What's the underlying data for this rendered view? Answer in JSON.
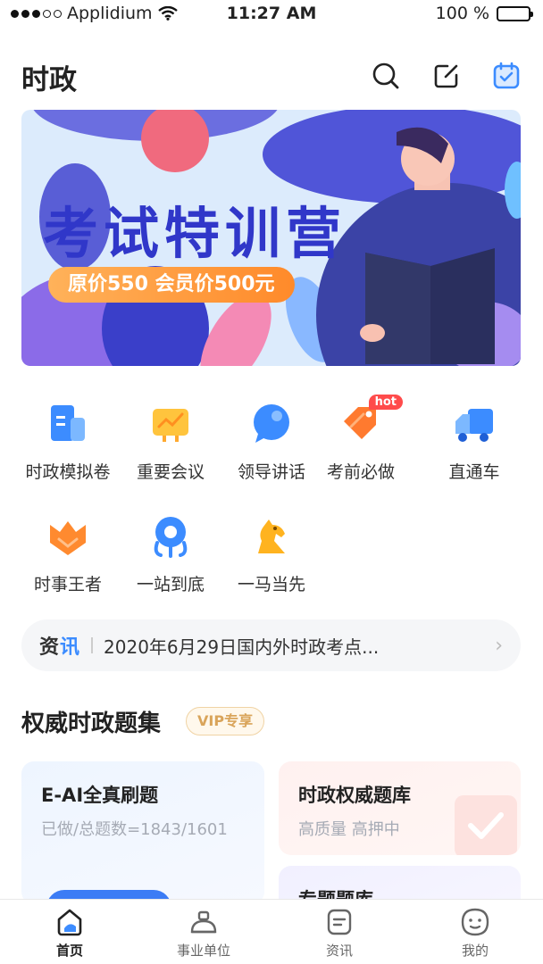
{
  "status_bar": {
    "carrier": "Applidium",
    "time": "11:27 AM",
    "battery": "100 %"
  },
  "header": {
    "title": "时政",
    "icons": [
      "search-icon",
      "edit-icon",
      "calendar-check-icon"
    ]
  },
  "banner": {
    "title": "考试特训营",
    "price": "原价550  会员价500元"
  },
  "quick_links": [
    {
      "label": "时政模拟卷",
      "icon": "document-icon",
      "badge": ""
    },
    {
      "label": "重要会议",
      "icon": "chart-board-icon",
      "badge": ""
    },
    {
      "label": "领导讲话",
      "icon": "chat-bubble-icon",
      "badge": ""
    },
    {
      "label": "考前必做",
      "icon": "tag-icon",
      "badge": "hot"
    },
    {
      "label": "直通车",
      "icon": "truck-icon",
      "badge": ""
    },
    {
      "label": "时事王者",
      "icon": "crown-icon",
      "badge": ""
    },
    {
      "label": "一站到底",
      "icon": "location-icon",
      "badge": ""
    },
    {
      "label": "一马当先",
      "icon": "horse-icon",
      "badge": ""
    }
  ],
  "news": {
    "tag_part1": "资",
    "tag_part2": "讯",
    "text": "2020年6月29日国内外时政考点..."
  },
  "section": {
    "title": "权威时政题集",
    "vip": "VIP专享"
  },
  "cards": [
    {
      "title": "E-AI全真刷题",
      "subtitle": "已做/总题数=1843/1601"
    },
    {
      "title": "时政权威题库",
      "subtitle": "高质量 高押中"
    },
    {
      "title": "专题题库",
      "subtitle": ""
    }
  ],
  "tabs": [
    {
      "label": "首页",
      "icon": "home-icon",
      "active": true
    },
    {
      "label": "事业单位",
      "icon": "briefcase-icon",
      "active": false
    },
    {
      "label": "资讯",
      "icon": "news-icon",
      "active": false
    },
    {
      "label": "我的",
      "icon": "profile-icon",
      "active": false
    }
  ],
  "colors": {
    "accent": "#3c8cff",
    "banner_title": "#3037c9",
    "hot": "#ff4b4b",
    "vip": "#d9a45a"
  }
}
